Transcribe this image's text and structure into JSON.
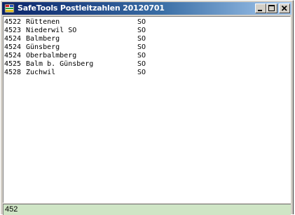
{
  "window": {
    "title": "SafeTools Postleitzahlen 20120701",
    "icon": "safetools-app-icon",
    "controls": {
      "minimize_icon": "minimize-icon",
      "maximize_icon": "maximize-icon",
      "close_icon": "close-icon"
    }
  },
  "results": [
    {
      "code": "4522",
      "name": "Rüttenen",
      "canton": "SO"
    },
    {
      "code": "4523",
      "name": "Niederwil SO",
      "canton": "SO"
    },
    {
      "code": "4524",
      "name": "Balmberg",
      "canton": "SO"
    },
    {
      "code": "4524",
      "name": "Günsberg",
      "canton": "SO"
    },
    {
      "code": "4524",
      "name": "Oberbalmberg",
      "canton": "SO"
    },
    {
      "code": "4525",
      "name": "Balm b. Günsberg",
      "canton": "SO"
    },
    {
      "code": "4528",
      "name": "Zuchwil",
      "canton": "SO"
    }
  ],
  "search": {
    "value": "452"
  },
  "colors": {
    "title_gradient_start": "#0a246a",
    "title_gradient_end": "#a6caf0",
    "input_background": "#cfe5c5"
  }
}
